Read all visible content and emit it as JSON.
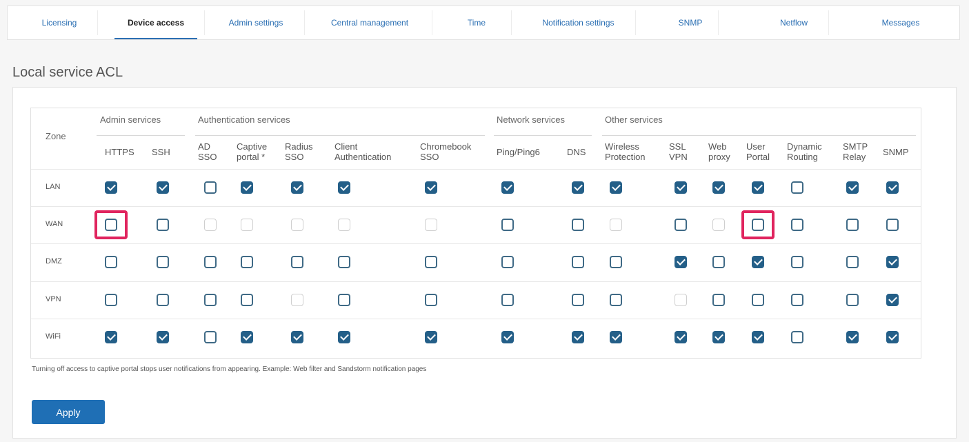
{
  "tabs": [
    {
      "id": "licensing",
      "label": "Licensing",
      "active": false
    },
    {
      "id": "device-access",
      "label": "Device access",
      "active": true
    },
    {
      "id": "admin-settings",
      "label": "Admin settings",
      "active": false
    },
    {
      "id": "central-management",
      "label": "Central management",
      "active": false
    },
    {
      "id": "time",
      "label": "Time",
      "active": false
    },
    {
      "id": "notification-settings",
      "label": "Notification settings",
      "active": false
    },
    {
      "id": "snmp",
      "label": "SNMP",
      "active": false
    },
    {
      "id": "netflow",
      "label": "Netflow",
      "active": false
    },
    {
      "id": "messages",
      "label": "Messages",
      "active": false
    }
  ],
  "section_title": "Local service ACL",
  "zone_header": "Zone",
  "groups": [
    "Admin services",
    "Authentication services",
    "Network services",
    "Other services"
  ],
  "columns": [
    {
      "id": "https",
      "label": "HTTPS"
    },
    {
      "id": "ssh",
      "label": "SSH"
    },
    {
      "id": "ad-sso",
      "label": "AD\nSSO"
    },
    {
      "id": "captive-portal",
      "label": "Captive\nportal *"
    },
    {
      "id": "radius-sso",
      "label": "Radius\nSSO"
    },
    {
      "id": "client-auth",
      "label": "Client\nAuthentication"
    },
    {
      "id": "chromebook-sso",
      "label": "Chromebook\nSSO"
    },
    {
      "id": "ping",
      "label": "Ping/Ping6"
    },
    {
      "id": "dns",
      "label": "DNS"
    },
    {
      "id": "wireless-protection",
      "label": "Wireless\nProtection"
    },
    {
      "id": "ssl-vpn",
      "label": "SSL\nVPN"
    },
    {
      "id": "web-proxy",
      "label": "Web\nproxy"
    },
    {
      "id": "user-portal",
      "label": "User\nPortal"
    },
    {
      "id": "dynamic-routing",
      "label": "Dynamic\nRouting"
    },
    {
      "id": "smtp-relay",
      "label": "SMTP\nRelay"
    },
    {
      "id": "snmp",
      "label": "SNMP"
    }
  ],
  "rows": [
    {
      "zone": "LAN",
      "states": [
        1,
        1,
        0,
        1,
        1,
        1,
        1,
        1,
        1,
        1,
        1,
        1,
        1,
        0,
        1,
        1
      ]
    },
    {
      "zone": "WAN",
      "states": [
        0,
        0,
        2,
        2,
        2,
        2,
        2,
        0,
        0,
        2,
        0,
        2,
        0,
        0,
        0,
        0
      ]
    },
    {
      "zone": "DMZ",
      "states": [
        0,
        0,
        0,
        0,
        0,
        0,
        0,
        0,
        0,
        0,
        1,
        0,
        1,
        0,
        0,
        1
      ]
    },
    {
      "zone": "VPN",
      "states": [
        0,
        0,
        0,
        0,
        2,
        0,
        0,
        0,
        0,
        0,
        2,
        0,
        0,
        0,
        0,
        1
      ]
    },
    {
      "zone": "WiFi",
      "states": [
        1,
        1,
        0,
        1,
        1,
        1,
        1,
        1,
        1,
        1,
        1,
        1,
        1,
        0,
        1,
        1
      ]
    }
  ],
  "state_legend": {
    "0": "unchecked",
    "1": "checked",
    "2": "disabled"
  },
  "highlighted_cells": [
    {
      "zone": "WAN",
      "column": "HTTPS"
    },
    {
      "zone": "WAN",
      "column": "User Portal"
    }
  ],
  "highlight_color": "#e0245e",
  "accent_color": "#1f6fb5",
  "note": "Turning off access to captive portal stops user notifications from appearing. Example: Web filter and Sandstorm notification pages",
  "apply_label": "Apply"
}
